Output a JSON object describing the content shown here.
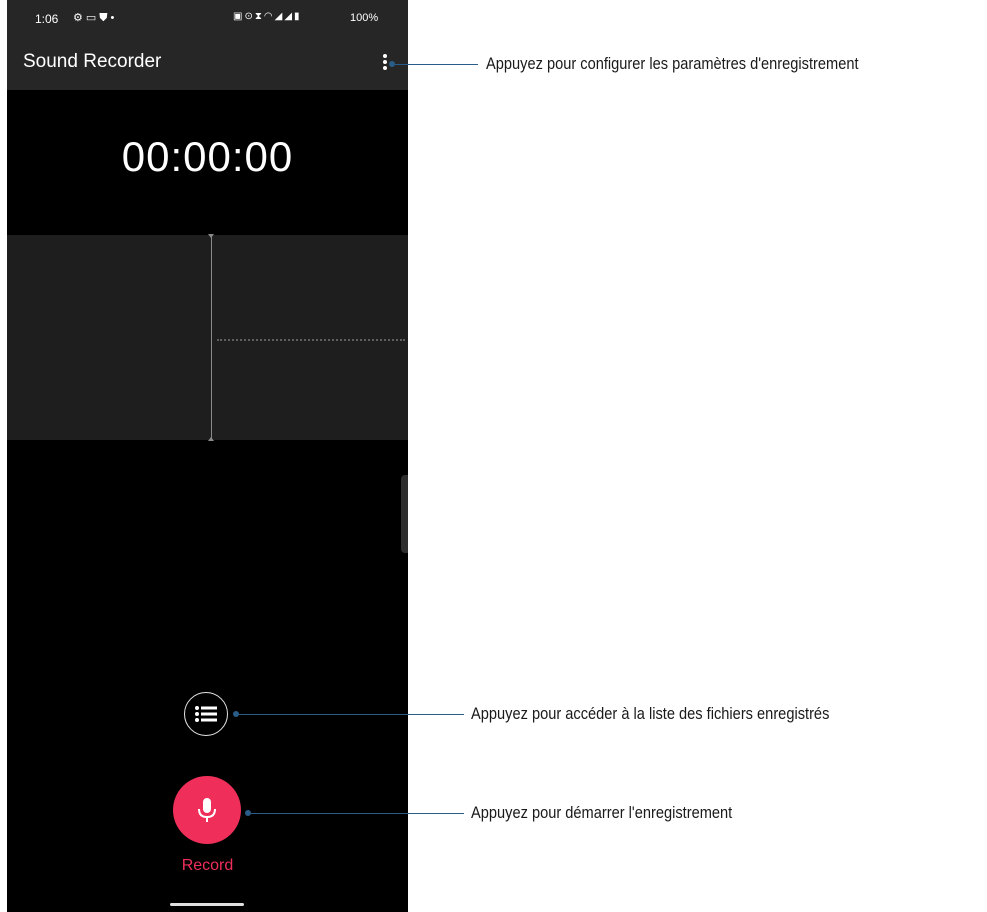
{
  "status_bar": {
    "time": "1:06",
    "left_icons": [
      "settings-gear-icon",
      "sim-card-icon",
      "shield-icon",
      "notification-dot-icon"
    ],
    "right_icons": [
      "cast-icon",
      "sync-icon",
      "hourglass-icon",
      "wifi-icon",
      "signal-icon",
      "signal-icon",
      "battery-icon"
    ],
    "battery": "100%"
  },
  "app_bar": {
    "title": "Sound Recorder",
    "menu_icon": "more-vert-icon"
  },
  "recorder": {
    "timer": "00:00:00",
    "list_icon": "list-icon",
    "record_icon": "microphone-icon",
    "record_label": "Record"
  },
  "callouts": {
    "settings": "Appuyez pour configurer les paramètres d'enregistrement",
    "list": "Appuyez pour accéder à la liste des fichiers enregistrés",
    "record": "Appuyez pour démarrer l'enregistrement"
  },
  "colors": {
    "accent": "#ef2f5a",
    "bar": "#262626",
    "background": "#000000",
    "callout_line": "#2a5c8a"
  }
}
